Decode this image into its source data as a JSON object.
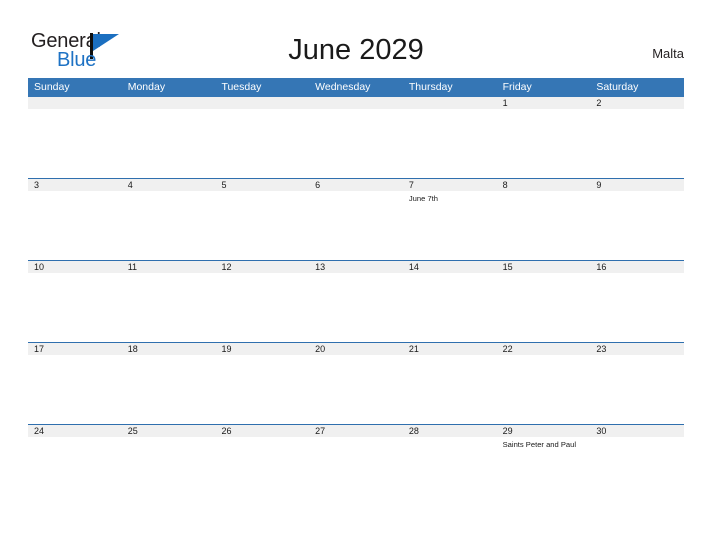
{
  "brand": {
    "name_part1": "General",
    "name_part2": "Blue",
    "flag_color": "#1b6fc0",
    "blue_color": "#1e72c4"
  },
  "header": {
    "title": "June 2029",
    "country": "Malta"
  },
  "calendar": {
    "header_bg": "#3576b5",
    "daynum_bg": "#f0f0f0",
    "rule_color": "#2f6fae",
    "weekdays": [
      "Sunday",
      "Monday",
      "Tuesday",
      "Wednesday",
      "Thursday",
      "Friday",
      "Saturday"
    ],
    "weeks": [
      {
        "days": [
          {
            "num": "",
            "events": []
          },
          {
            "num": "",
            "events": []
          },
          {
            "num": "",
            "events": []
          },
          {
            "num": "",
            "events": []
          },
          {
            "num": "",
            "events": []
          },
          {
            "num": "1",
            "events": []
          },
          {
            "num": "2",
            "events": []
          }
        ]
      },
      {
        "days": [
          {
            "num": "3",
            "events": []
          },
          {
            "num": "4",
            "events": []
          },
          {
            "num": "5",
            "events": []
          },
          {
            "num": "6",
            "events": []
          },
          {
            "num": "7",
            "events": [
              "June 7th"
            ]
          },
          {
            "num": "8",
            "events": []
          },
          {
            "num": "9",
            "events": []
          }
        ]
      },
      {
        "days": [
          {
            "num": "10",
            "events": []
          },
          {
            "num": "11",
            "events": []
          },
          {
            "num": "12",
            "events": []
          },
          {
            "num": "13",
            "events": []
          },
          {
            "num": "14",
            "events": []
          },
          {
            "num": "15",
            "events": []
          },
          {
            "num": "16",
            "events": []
          }
        ]
      },
      {
        "days": [
          {
            "num": "17",
            "events": []
          },
          {
            "num": "18",
            "events": []
          },
          {
            "num": "19",
            "events": []
          },
          {
            "num": "20",
            "events": []
          },
          {
            "num": "21",
            "events": []
          },
          {
            "num": "22",
            "events": []
          },
          {
            "num": "23",
            "events": []
          }
        ]
      },
      {
        "days": [
          {
            "num": "24",
            "events": []
          },
          {
            "num": "25",
            "events": []
          },
          {
            "num": "26",
            "events": []
          },
          {
            "num": "27",
            "events": []
          },
          {
            "num": "28",
            "events": []
          },
          {
            "num": "29",
            "events": [
              "Saints Peter and Paul"
            ]
          },
          {
            "num": "30",
            "events": []
          }
        ]
      }
    ]
  }
}
